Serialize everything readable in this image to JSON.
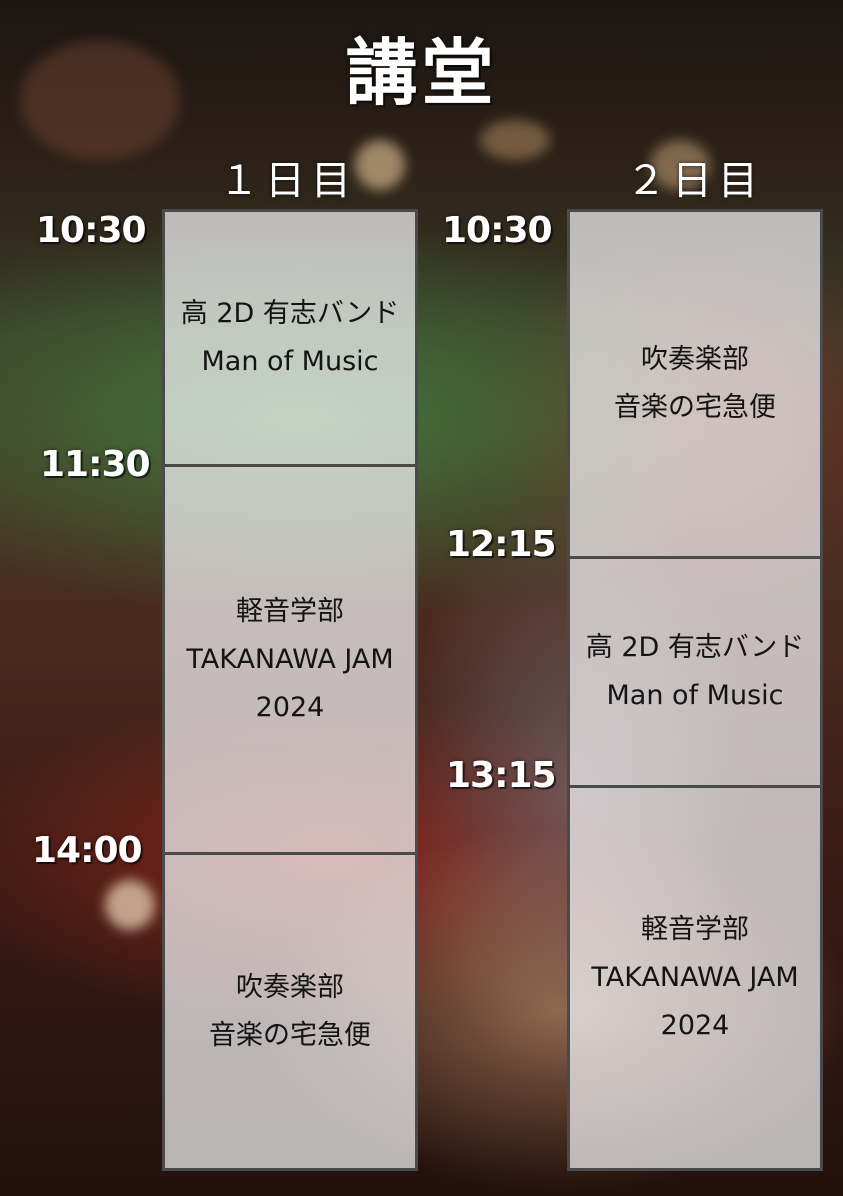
{
  "title": "講堂",
  "days": [
    {
      "label": "１日目",
      "slots": [
        {
          "time": "10:30",
          "lines": [
            "高 2D 有志バンド",
            "Man of Music"
          ]
        },
        {
          "time": "11:30",
          "lines": [
            "軽音学部",
            "TAKANAWA JAM",
            "2024"
          ]
        },
        {
          "time": "14:00",
          "lines": [
            "吹奏楽部",
            "音楽の宅急便"
          ]
        }
      ]
    },
    {
      "label": "２日目",
      "slots": [
        {
          "time": "10:30",
          "lines": [
            "吹奏楽部",
            "音楽の宅急便"
          ]
        },
        {
          "time": "12:15",
          "lines": [
            "高 2D 有志バンド",
            "Man of Music"
          ]
        },
        {
          "time": "13:15",
          "lines": [
            "軽音学部",
            "TAKANAWA JAM",
            "2024"
          ]
        }
      ]
    }
  ]
}
